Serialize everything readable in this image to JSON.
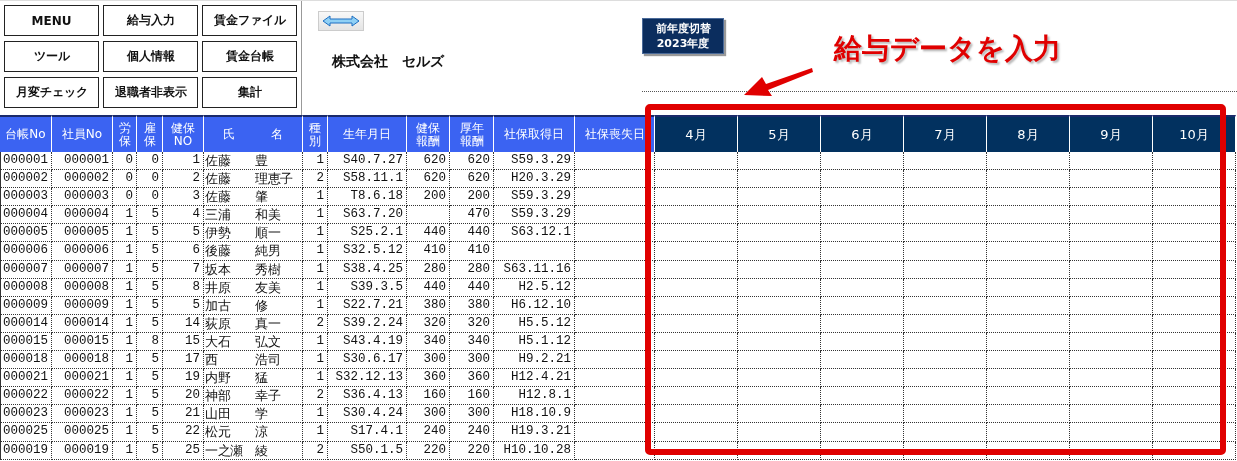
{
  "menu_buttons": [
    {
      "label": "MENU"
    },
    {
      "label": "給与入力"
    },
    {
      "label": "賃金ファイル"
    },
    {
      "label": "ツール"
    },
    {
      "label": "個人情報"
    },
    {
      "label": "賃金台帳"
    },
    {
      "label": "月変チェック"
    },
    {
      "label": "退職者非表示"
    },
    {
      "label": "集計"
    }
  ],
  "company_name": "株式会社　セルズ",
  "year_switch": {
    "label": "前年度切替",
    "year": "2023年度"
  },
  "annotation": {
    "text": "給与データを入力"
  },
  "table": {
    "columns": [
      "台帳No",
      "社員No",
      "労保",
      "雇保",
      "健保NO",
      "氏　　　名",
      "種別",
      "生年月日",
      "健保報酬",
      "厚年報酬",
      "社保取得日",
      "社保喪失日"
    ],
    "months": [
      "4月",
      "5月",
      "6月",
      "7月",
      "8月",
      "9月",
      "10月"
    ],
    "rows": [
      [
        "000001",
        "000001",
        "0",
        "0",
        "1",
        "佐藤　　豊",
        "1",
        "S40.7.27",
        "620",
        "620",
        "S59.3.29"
      ],
      [
        "000002",
        "000002",
        "0",
        "0",
        "2",
        "佐藤　　理恵子",
        "2",
        "S58.11.1",
        "620",
        "620",
        "H20.3.29"
      ],
      [
        "000003",
        "000003",
        "0",
        "0",
        "3",
        "佐藤　　肇",
        "1",
        "T8.6.18",
        "200",
        "200",
        "S59.3.29"
      ],
      [
        "000004",
        "000004",
        "1",
        "5",
        "4",
        "三浦　　和美",
        "1",
        "S63.7.20",
        null,
        "470",
        "S59.3.29"
      ],
      [
        "000005",
        "000005",
        "1",
        "5",
        "5",
        "伊勢　　順一",
        "1",
        "S25.2.1",
        "440",
        "440",
        "S63.12.1"
      ],
      [
        "000006",
        "000006",
        "1",
        "5",
        "6",
        "後藤　　純男",
        "1",
        "S32.5.12",
        "410",
        "410",
        null
      ],
      [
        "000007",
        "000007",
        "1",
        "5",
        "7",
        "坂本　　秀樹",
        "1",
        "S38.4.25",
        "280",
        "280",
        "S63.11.16"
      ],
      [
        "000008",
        "000008",
        "1",
        "5",
        "8",
        "井原　　友美",
        "1",
        "S39.3.5",
        "440",
        "440",
        "H2.5.12"
      ],
      [
        "000009",
        "000009",
        "1",
        "5",
        "5",
        "加古　　修",
        "1",
        "S22.7.21",
        "380",
        "380",
        "H6.12.10"
      ],
      [
        "000014",
        "000014",
        "1",
        "5",
        "14",
        "荻原　　真一",
        "2",
        "S39.2.24",
        "320",
        "320",
        "H5.5.12"
      ],
      [
        "000015",
        "000015",
        "1",
        "8",
        "15",
        "大石　　弘文",
        "1",
        "S43.4.19",
        "340",
        "340",
        "H5.1.12"
      ],
      [
        "000018",
        "000018",
        "1",
        "5",
        "17",
        "西　　　浩司",
        "1",
        "S30.6.17",
        "300",
        "300",
        "H9.2.21"
      ],
      [
        "000021",
        "000021",
        "1",
        "5",
        "19",
        "内野　　猛",
        "1",
        "S32.12.13",
        "360",
        "360",
        "H12.4.21"
      ],
      [
        "000022",
        "000022",
        "1",
        "5",
        "20",
        "神部　　幸子",
        "2",
        "S36.4.13",
        "160",
        "160",
        "H12.8.1"
      ],
      [
        "000023",
        "000023",
        "1",
        "5",
        "21",
        "山田　　学",
        "1",
        "S30.4.24",
        "300",
        "300",
        "H18.10.9"
      ],
      [
        "000025",
        "000025",
        "1",
        "5",
        "22",
        "松元　　涼",
        "1",
        "S17.4.1",
        "240",
        "240",
        "H19.3.21"
      ],
      [
        "000019",
        "000019",
        "1",
        "5",
        "25",
        "一之瀬　綾",
        "2",
        "S50.1.5",
        "220",
        "220",
        "H10.10.28"
      ]
    ]
  }
}
